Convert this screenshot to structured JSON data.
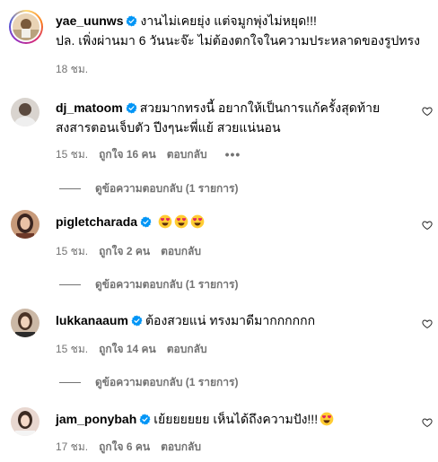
{
  "caption": {
    "username": "yae_uunws",
    "line1": "งานไม่เคยยุ่ง แต่จมูกพุ่งไม่หยุด!!!",
    "line2": "ปล. เพิ่งผ่านมา 6 วันนะจ๊ะ ไม่ต้องตกใจในความประหลาดของรูปทรง",
    "time": "18 ชม."
  },
  "comments": [
    {
      "username": "dj_matoom",
      "line1": "สวยมากทรงนี้ อยากให้เป็นการแก้ครั้งสุดท้าย",
      "line2": "สงสารตอนเจ็บตัว ปีงๆนะพี่แย้ สวยแน่นอน",
      "time": "15 ชม.",
      "likes": "ถูกใจ 16 คน",
      "reply": "ตอบกลับ",
      "more": "•••",
      "view_replies": "ดูข้อความตอบกลับ (1 รายการ)"
    },
    {
      "username": "pigletcharada",
      "text": "",
      "emojis": [
        "heart-eyes-emoji",
        "heart-eyes-emoji",
        "heart-eyes-emoji"
      ],
      "time": "15 ชม.",
      "likes": "ถูกใจ 2 คน",
      "reply": "ตอบกลับ",
      "view_replies": "ดูข้อความตอบกลับ (1 รายการ)"
    },
    {
      "username": "lukkanaaum",
      "text": "ต้องสวยแน่ ทรงมาดีมากกกกกก",
      "time": "15 ชม.",
      "likes": "ถูกใจ 14 คน",
      "reply": "ตอบกลับ",
      "view_replies": "ดูข้อความตอบกลับ (1 รายการ)"
    },
    {
      "username": "jam_ponybah",
      "text": "เย้ยยยยยย เห็นได้ถึงความปัง!!!",
      "emojis": [
        "heart-eyes-emoji"
      ],
      "time": "17 ชม.",
      "likes": "ถูกใจ 6 คน",
      "reply": "ตอบกลับ"
    }
  ],
  "icons": {
    "verified": "verified-badge-icon",
    "like": "heart-outline-icon"
  },
  "colors": {
    "verified_blue": "#0095f6",
    "meta_gray": "#737373"
  }
}
